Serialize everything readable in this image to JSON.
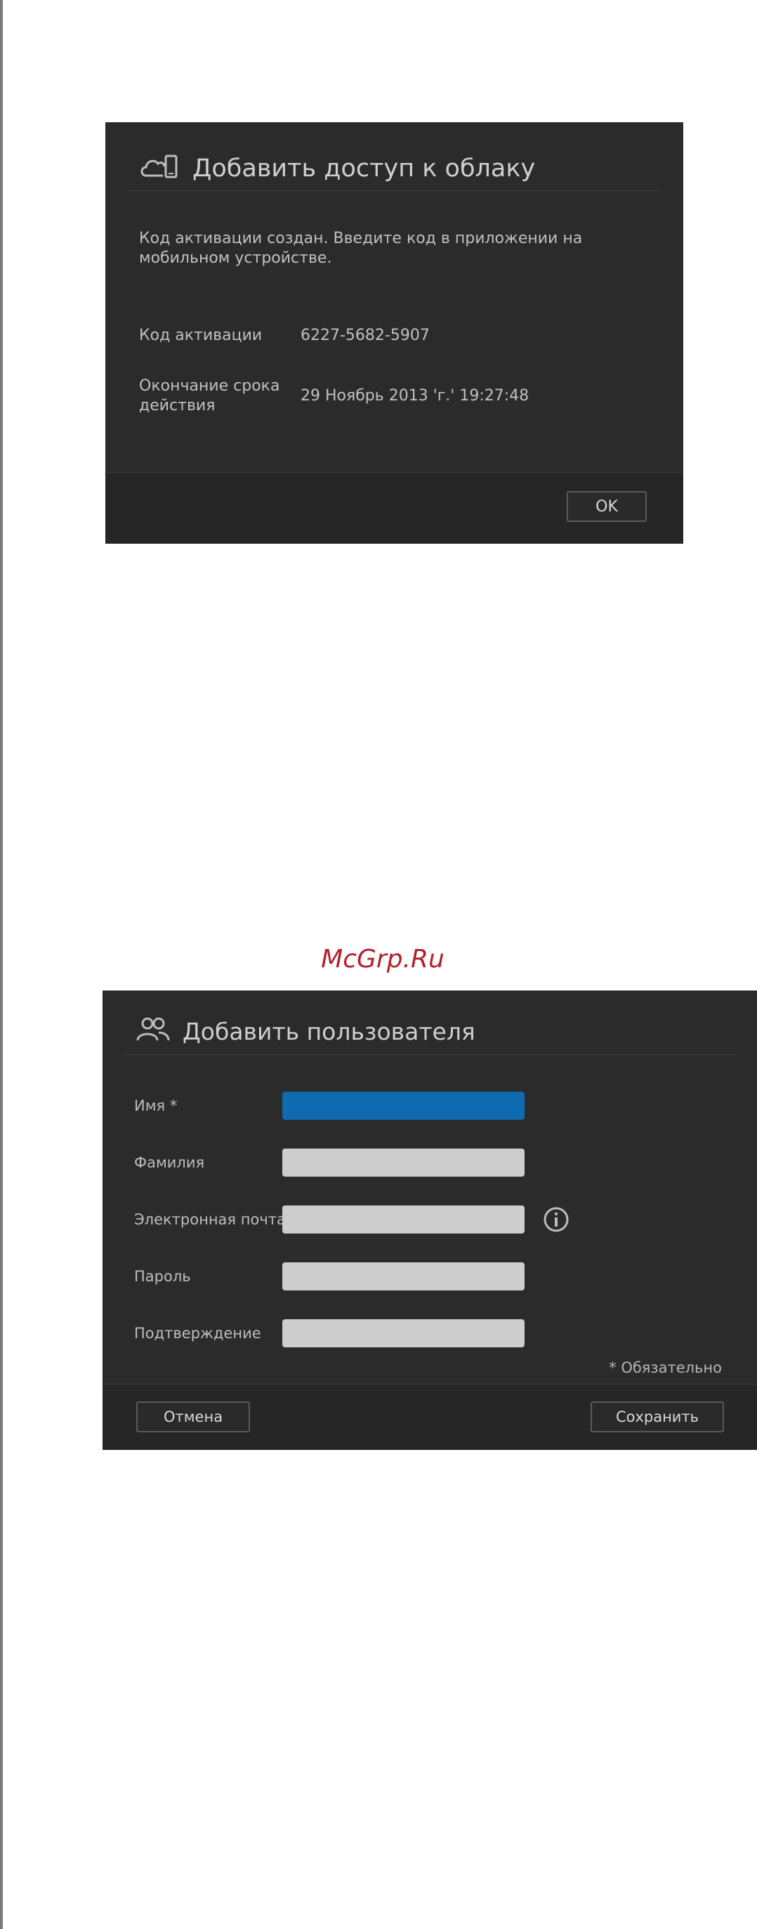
{
  "cloud_dialog": {
    "title": "Добавить доступ к облаку",
    "icon": "cloud-mobile-icon",
    "message": "Код активации создан. Введите код в приложении на мобильном устройстве.",
    "activation_code_label": "Код активации",
    "activation_code_value": "6227-5682-5907",
    "expiry_label": "Окончание срока действия",
    "expiry_value": "29 Ноябрь 2013 'г.' 19:27:48",
    "ok_label": "OK"
  },
  "watermark": "McGrp.Ru",
  "user_dialog": {
    "title": "Добавить пользователя",
    "icon": "users-icon",
    "fields": {
      "first_name_label": "Имя *",
      "last_name_label": "Фамилия",
      "email_label": "Электронная почта",
      "password_label": "Пароль",
      "confirm_label": "Подтверждение"
    },
    "required_note": "* Обязательно",
    "cancel_label": "Отмена",
    "save_label": "Сохранить"
  },
  "colors": {
    "dialog_bg": "#2b2b2b",
    "active_input": "#0e6bb0",
    "input_bg": "#cdcdcd",
    "watermark": "#b3202a"
  }
}
